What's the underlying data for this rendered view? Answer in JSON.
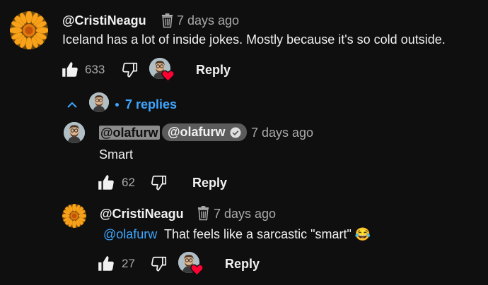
{
  "top_comment": {
    "author": "@CristiNeagu",
    "timestamp": "7 days ago",
    "text": "Iceland has a lot of inside jokes. Mostly because it's so cold outside.",
    "like_count": "633",
    "reply_label": "Reply"
  },
  "replies_toggle": {
    "label": "7 replies"
  },
  "reply1": {
    "author_mention": "@olafurw",
    "owner_badge": "@olafurw",
    "timestamp": "7 days ago",
    "text": "Smart",
    "like_count": "62",
    "reply_label": "Reply"
  },
  "reply2": {
    "author": "@CristiNeagu",
    "timestamp": "7 days ago",
    "mention": "@olafurw",
    "text": "That feels like a sarcastic \"smart\"",
    "emoji": "😂",
    "like_count": "27",
    "reply_label": "Reply"
  },
  "colors": {
    "background": "#0f0f0f",
    "link": "#3ea6ff",
    "heart": "#ff0033",
    "muted": "#aaaaaa"
  },
  "icons": [
    "flower-avatar",
    "trash-icon",
    "thumb-up-icon",
    "thumb-down-icon",
    "creator-heart-icon",
    "chevron-up-icon",
    "verified-check-icon"
  ]
}
